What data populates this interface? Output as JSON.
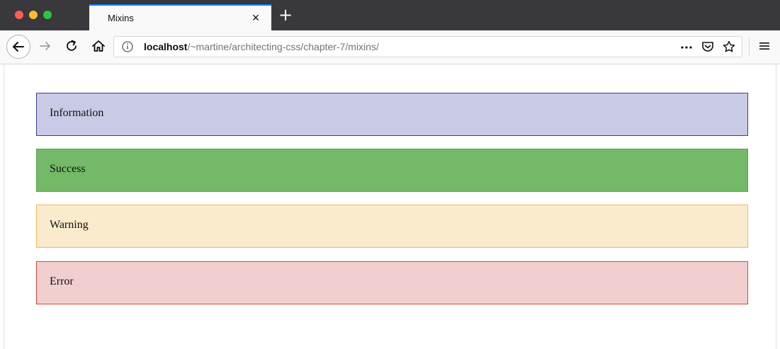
{
  "browser": {
    "tab": {
      "title": "Mixins",
      "close_label": "×"
    },
    "new_tab_label": "+",
    "address": {
      "host": "localhost",
      "path": "/~martine/architecting-css/chapter-7/mixins/"
    },
    "icons": {
      "traffic": [
        "close-window-icon",
        "minimize-window-icon",
        "maximize-window-icon"
      ],
      "nav": [
        "back-arrow-icon",
        "forward-arrow-icon",
        "reload-icon",
        "home-icon"
      ],
      "urlbar": [
        "info-icon",
        "more-actions-icon",
        "pocket-icon",
        "bookmark-star-icon"
      ],
      "menu": "hamburger-menu-icon"
    }
  },
  "page": {
    "alerts": [
      {
        "label": "Information",
        "background": "#c9cae6",
        "border": "#3b3f8f"
      },
      {
        "label": "Success",
        "background": "#73b967",
        "border": "#5aa14f"
      },
      {
        "label": "Warning",
        "background": "#fbebcd",
        "border": "#f1b55d"
      },
      {
        "label": "Error",
        "background": "#f2cfcf",
        "border": "#e0403a"
      }
    ]
  }
}
